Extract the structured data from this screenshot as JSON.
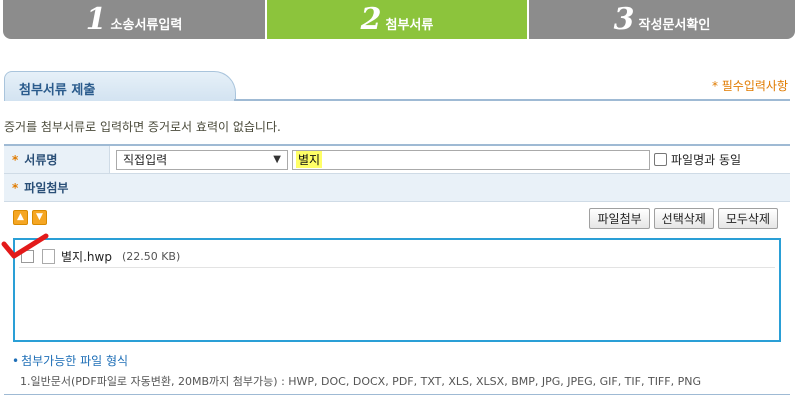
{
  "steps": [
    {
      "num": "1",
      "label": "소송서류입력"
    },
    {
      "num": "2",
      "label": "첨부서류"
    },
    {
      "num": "3",
      "label": "작성문서확인"
    }
  ],
  "section": {
    "tab_label": "첨부서류 제출",
    "required_note": "* 필수입력사항"
  },
  "notice": "증거를 첨부서류로 입력하면 증거로서 효력이 없습니다.",
  "form": {
    "doc_name_label": "서류명",
    "star": "*",
    "select_value": "직접입력",
    "doc_name_value": "별지",
    "same_as_filename_label": "파일명과 동일",
    "attach_label": "파일첨부"
  },
  "buttons": {
    "attach": "파일첨부",
    "delete_selected": "선택삭제",
    "delete_all": "모두삭제"
  },
  "files": [
    {
      "name": "별지.hwp",
      "size": "(22.50 KB)"
    }
  ],
  "formats": {
    "title": "첨부가능한 파일 형식",
    "line1": "1.일반문서(PDF파일로 자동변환, 20MB까지 첨부가능) : HWP, DOC, DOCX, PDF, TXT, XLS, XLSX, BMP, JPG, JPEG, GIF, TIF, TIFF, PNG"
  },
  "colors": {
    "step_active": "#8cc43c",
    "step_inactive": "#8c8c8c",
    "accent_blue": "#2a9fd6",
    "required_orange": "#e07b00"
  }
}
